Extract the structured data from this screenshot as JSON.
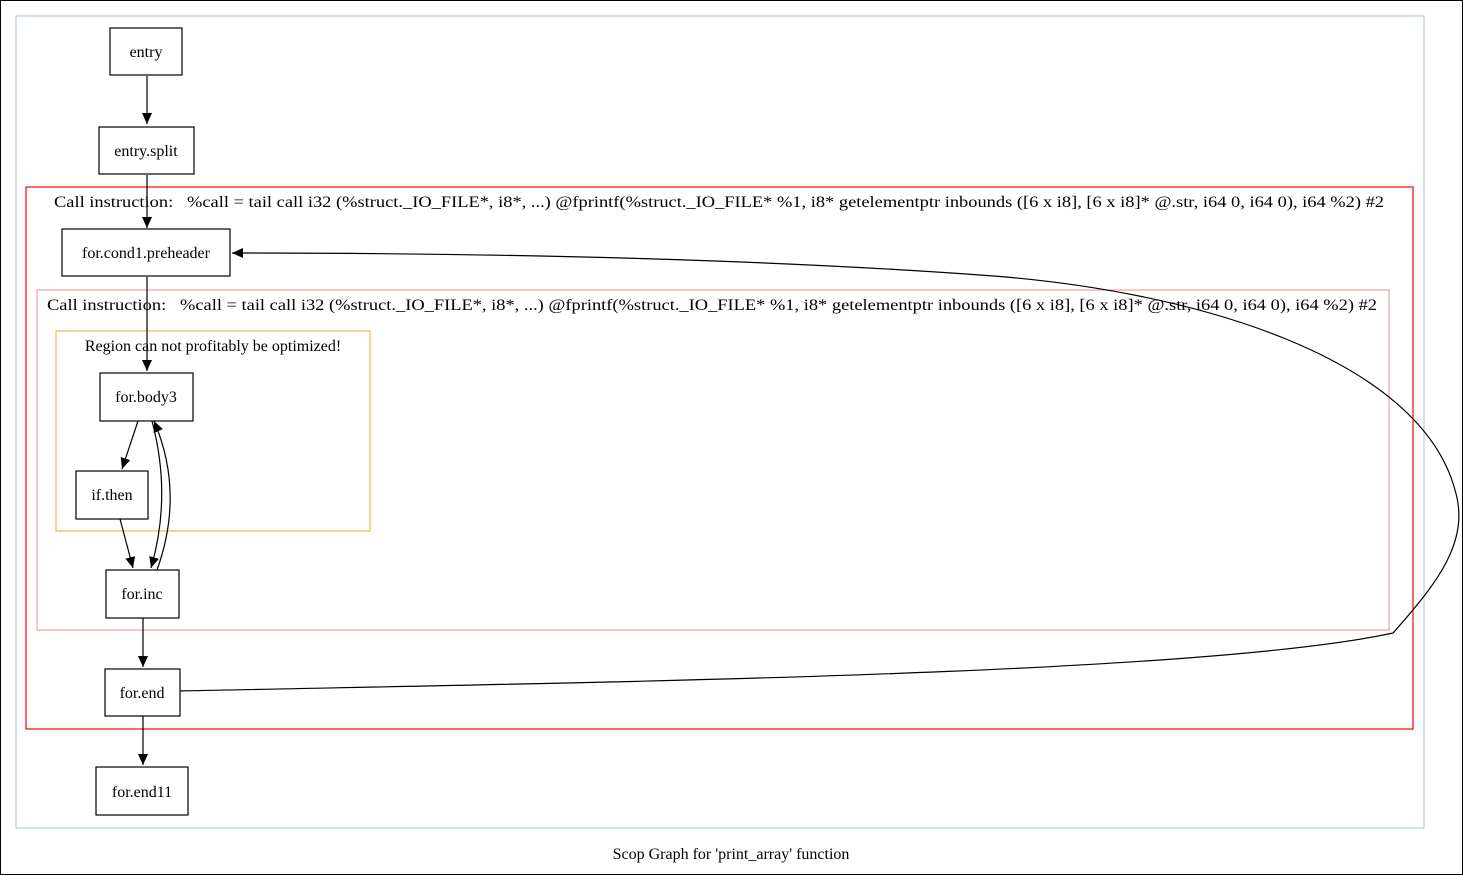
{
  "graph": {
    "caption": "Scop Graph for 'print_array' function"
  },
  "clusters": {
    "outer_region": {
      "label": "Call instruction:   %call = tail call i32 (%struct._IO_FILE*, i8*, ...) @fprintf(%struct._IO_FILE* %1, i8* getelementptr inbounds ([6 x i8], [6 x i8]* @.str, i64 0, i64 0), i64 %2) #2",
      "color": "#ff0000"
    },
    "inner_region": {
      "label": "Call instruction:   %call = tail call i32 (%struct._IO_FILE*, i8*, ...) @fprintf(%struct._IO_FILE* %1, i8* getelementptr inbounds ([6 x i8], [6 x i8]* @.str, i64 0, i64 0), i64 %2) #2",
      "color": "#f4a0a0"
    },
    "loop_region": {
      "label": "Region can not profitably be optimized!",
      "color": "#f5b050"
    },
    "function_frame": {
      "color": "#b0d0e0"
    }
  },
  "nodes": {
    "entry": "entry",
    "entry_split": "entry.split",
    "for_cond1_preheader": "for.cond1.preheader",
    "for_body3": "for.body3",
    "if_then": "if.then",
    "for_inc": "for.inc",
    "for_end": "for.end",
    "for_end11": "for.end11"
  }
}
